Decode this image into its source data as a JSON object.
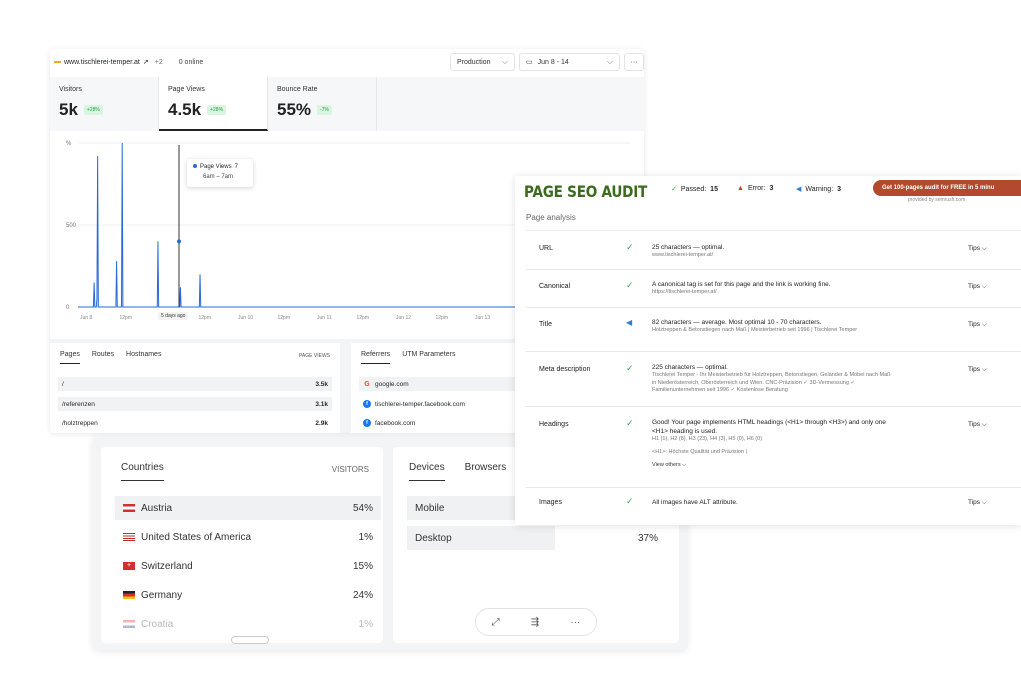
{
  "analytics": {
    "site": "www.tischlerei-temper.at",
    "site_extra": "+2",
    "online": "0 online",
    "environment": "Production",
    "date_range": "Jun 8 - 14",
    "more": "···",
    "metrics": [
      {
        "label": "Visitors",
        "value": "5k",
        "badge": "+28%"
      },
      {
        "label": "Page Views",
        "value": "4.5k",
        "badge": "+28%"
      },
      {
        "label": "Bounce Rate",
        "value": "55%",
        "badge": "-7%"
      }
    ],
    "tooltip": {
      "series": "Page Views",
      "value": "7",
      "time": "6am – 7am"
    },
    "days_ago": "5 days ago",
    "pages_card": {
      "tabs": [
        "Pages",
        "Routes",
        "Hostnames"
      ],
      "column": "PAGE VIEWS",
      "rows": [
        {
          "label": "/",
          "value": "3.5k"
        },
        {
          "label": "/referenzen",
          "value": "3.1k"
        },
        {
          "label": "/holztreppen",
          "value": "2.9k"
        }
      ]
    },
    "referrers_card": {
      "tabs": [
        "Referrers",
        "UTM Parameters"
      ],
      "rows": [
        {
          "label": "google.com",
          "icon": "google-icon"
        },
        {
          "label": "tischlerei-temper.facebook.com",
          "icon": "facebook-icon"
        },
        {
          "label": "facebook.com",
          "icon": "facebook-icon"
        }
      ]
    }
  },
  "chart_data": {
    "type": "area",
    "title": "",
    "xlabel": "",
    "ylabel": "",
    "y_ticks": [
      "%",
      "500",
      "0"
    ],
    "x_ticks": [
      "Jun 8",
      "12pm",
      "Jun 9",
      "12pm",
      "Jun 10",
      "12pm",
      "Jun 11",
      "12pm",
      "Jun 12",
      "12pm",
      "Jun 13",
      "12pm"
    ],
    "ylim": [
      0,
      1000
    ],
    "series": [
      {
        "name": "Page Views",
        "color": "#2a6ad8",
        "values": [
          0,
          0,
          0,
          0,
          0,
          0,
          0,
          0,
          0,
          0,
          0,
          0,
          0,
          0,
          0,
          0,
          0,
          0,
          0,
          0,
          0,
          0,
          0,
          150,
          0,
          0,
          0,
          50,
          920,
          0,
          0,
          0,
          0,
          0,
          0,
          0,
          0,
          0,
          0,
          0,
          0,
          0,
          0,
          0,
          0,
          0,
          0,
          0,
          0,
          0,
          0,
          0,
          0,
          0,
          0,
          280,
          0,
          0,
          0,
          0,
          0,
          0,
          0,
          1000,
          0,
          0,
          0,
          0,
          0,
          0,
          0,
          0,
          0,
          0,
          0,
          0,
          0,
          0,
          0,
          0,
          0,
          0,
          0,
          0,
          0,
          0,
          0,
          0,
          0,
          0,
          0,
          0,
          0,
          0,
          0,
          0,
          0,
          0,
          0,
          0,
          0,
          0,
          0,
          0,
          0,
          0,
          0,
          0,
          0,
          0,
          0,
          0,
          0,
          0,
          400,
          0,
          0,
          0,
          0,
          0,
          0,
          0,
          0,
          0,
          0,
          0,
          0,
          0,
          0,
          0,
          0,
          0,
          0,
          0,
          0,
          0,
          0,
          0,
          0,
          0,
          0,
          0,
          0,
          0,
          0,
          0,
          120,
          0,
          0,
          0,
          0,
          0,
          0,
          0,
          0,
          0,
          0,
          0,
          0,
          0,
          0,
          0,
          0,
          0,
          0,
          0,
          0,
          0,
          0,
          0,
          0,
          0,
          0,
          0,
          200,
          0,
          0,
          0,
          0,
          0,
          0,
          0,
          0,
          0,
          0,
          0,
          0,
          0,
          0,
          0,
          0,
          0,
          0,
          0,
          0,
          0,
          0,
          0,
          0,
          0,
          0,
          0,
          0,
          0,
          0,
          0,
          0,
          0,
          0,
          0,
          0,
          0,
          0,
          0,
          0,
          0,
          0,
          0,
          0,
          0,
          0,
          0,
          0,
          0,
          0,
          0,
          0,
          0,
          0,
          0,
          0,
          0,
          0,
          0,
          0,
          0,
          0,
          0,
          0,
          0,
          0,
          0,
          0,
          0,
          0,
          0,
          0,
          0,
          0,
          0,
          0,
          0,
          0,
          0,
          0,
          0,
          0,
          0,
          0,
          0,
          0,
          0,
          0,
          0,
          0,
          0,
          0,
          0,
          0,
          0,
          0,
          0,
          0,
          0,
          0,
          0,
          0,
          0,
          0,
          0,
          0,
          0,
          0,
          0,
          0,
          0,
          0,
          0,
          0,
          0,
          0,
          0,
          0,
          0,
          0,
          0,
          0,
          0,
          0,
          0,
          0,
          0,
          0,
          0,
          0,
          0,
          0,
          0,
          0,
          0,
          0,
          0,
          0,
          0,
          0,
          0,
          0,
          0,
          0,
          0,
          0,
          0,
          0,
          0,
          0,
          0,
          0,
          0,
          0,
          0,
          0,
          0,
          0,
          0,
          0,
          0,
          0,
          0,
          0,
          0,
          0,
          0,
          0,
          0,
          0,
          0,
          0,
          0,
          0,
          0,
          0,
          0,
          0,
          0,
          0,
          0,
          0,
          0,
          0,
          0,
          0,
          0,
          0,
          0,
          0,
          0,
          0,
          0,
          0,
          0,
          0,
          0,
          0,
          0,
          0,
          0,
          0,
          0,
          0,
          0,
          0,
          0,
          0,
          0,
          0,
          0,
          0,
          0,
          0,
          0,
          0,
          0,
          0,
          0,
          0,
          0,
          0,
          0,
          0,
          0,
          0,
          0,
          0,
          0,
          0,
          0,
          0,
          0,
          0,
          0,
          0,
          0,
          0,
          0,
          0,
          0,
          0,
          0,
          0,
          0,
          0,
          0,
          0,
          0,
          0,
          0,
          0,
          0,
          0,
          0,
          0,
          0,
          0,
          0,
          0,
          0,
          0,
          0,
          0,
          0,
          0,
          0,
          0,
          0,
          0,
          0,
          0,
          0,
          0,
          0,
          0,
          0,
          0,
          0,
          0,
          0,
          0,
          0,
          0,
          0,
          0,
          0,
          0,
          0,
          0,
          0,
          0,
          0,
          0,
          0,
          0,
          0,
          0,
          0,
          0,
          0,
          0,
          0,
          0,
          0,
          0,
          0,
          0,
          0,
          0,
          0,
          0,
          0,
          0,
          0,
          0,
          0,
          0,
          0,
          0,
          0,
          0,
          0,
          0,
          0,
          0,
          0,
          0,
          0,
          0,
          0,
          0,
          0,
          0,
          0,
          0,
          0,
          0,
          0,
          0,
          0,
          0,
          0,
          0,
          0,
          0,
          0,
          0,
          0,
          0,
          0,
          0,
          0,
          0,
          0,
          0,
          0,
          0,
          0,
          0,
          0,
          0,
          0,
          0,
          0,
          0,
          0,
          0,
          0,
          0,
          0,
          0,
          0,
          0,
          0,
          0,
          0,
          0,
          0,
          0,
          0,
          0,
          0,
          0,
          0,
          0,
          0,
          0,
          0,
          0,
          0,
          0,
          0,
          0,
          0,
          0,
          0,
          0,
          0,
          0,
          0,
          0,
          0,
          0,
          0,
          0,
          0,
          0,
          0,
          0,
          0,
          0,
          0,
          0,
          0,
          0,
          0,
          0,
          0,
          0,
          0,
          0,
          0,
          0,
          0,
          0,
          0,
          0,
          0,
          0,
          0,
          0,
          0,
          0,
          0,
          0,
          0,
          0,
          0,
          0,
          0,
          0,
          0,
          0,
          0,
          0,
          0,
          0,
          0,
          0,
          0,
          0,
          0,
          0,
          0,
          0,
          0,
          0,
          0,
          0,
          0,
          0,
          0,
          0,
          0,
          0,
          0,
          0,
          0,
          0,
          0,
          0,
          0,
          0,
          0,
          0,
          0,
          0,
          0,
          0,
          0,
          0,
          0,
          0,
          0,
          0,
          0,
          0,
          0,
          0,
          0,
          0,
          0,
          0,
          0,
          0,
          0,
          0,
          0,
          0,
          0,
          0,
          0,
          0,
          0,
          0,
          0,
          0,
          0,
          0,
          0,
          0,
          0,
          0,
          0,
          0,
          0,
          0,
          0,
          0,
          0,
          0,
          0,
          0,
          0,
          0,
          0,
          0,
          0,
          0,
          0,
          0,
          0,
          0,
          0,
          0,
          0,
          0,
          0,
          0,
          0,
          0,
          0,
          0,
          0,
          0,
          0,
          0,
          0,
          0,
          0,
          0,
          0,
          0,
          0,
          0,
          0,
          0,
          0,
          0,
          0,
          0,
          0,
          0,
          0,
          0,
          0,
          0,
          0,
          0,
          0,
          0,
          0,
          0,
          0,
          0,
          0,
          0,
          0,
          0,
          0,
          0,
          0,
          0,
          0,
          0,
          0,
          0,
          0,
          0,
          0,
          0,
          0,
          0,
          0,
          0,
          0,
          0,
          0,
          0,
          0,
          0,
          0,
          0,
          0,
          0,
          0,
          0,
          0,
          0,
          0,
          0,
          0
        ]
      }
    ]
  },
  "countries": {
    "tabs": [
      "Countries"
    ],
    "column": "VISITORS",
    "rows": [
      {
        "label": "Austria",
        "value": "54%"
      },
      {
        "label": "United States of America",
        "value": "1%"
      },
      {
        "label": "Switzerland",
        "value": "15%"
      },
      {
        "label": "Germany",
        "value": "24%"
      },
      {
        "label": "Croatia",
        "value": "1%"
      }
    ]
  },
  "devices": {
    "tabs": [
      "Devices",
      "Browsers"
    ],
    "rows": [
      {
        "label": "Mobile",
        "value": ""
      },
      {
        "label": "Desktop",
        "value": "37%"
      }
    ]
  },
  "seo": {
    "title": "PAGE SEO AUDIT",
    "passed_label": "Passed:",
    "passed": "15",
    "error_label": "Error:",
    "error": "3",
    "warning_label": "Warning:",
    "warning": "3",
    "cta": "Get 100-pages audit for FREE in 5 minu",
    "provided": "provided by semrush.com",
    "section": "Page analysis",
    "tips": "Tips",
    "rows": [
      {
        "name": "URL",
        "status": "ok",
        "text": "25 characters — optimal.",
        "sub": "www.tischlerei-temper.at/"
      },
      {
        "name": "Canonical",
        "status": "ok",
        "text": "A canonical tag is set for this page and the link is working fine.",
        "sub": "https://tischlerei-temper.at/"
      },
      {
        "name": "Title",
        "status": "warn",
        "text": "82 characters — average. Most optimal 10 - 70 characters.",
        "sub": "Holztreppen & Betonstiegen nach Maß | Meisterbetrieb seit 1996 | Tischlerei Temper"
      },
      {
        "name": "Meta description",
        "status": "ok",
        "text": "225 characters — optimal.",
        "sub": "Tischlerei Temper - Ihr Meisterbetrieb für Holztreppen, Betonstiegen, Geländer & Möbel nach Maß in Niederösterreich, Oberösterreich und Wien. CNC-Präzision ✓ 3D-Vermessung ✓ Familienunternehmen seit 1996 ✓ Kostenlose Beratung"
      },
      {
        "name": "Headings",
        "status": "ok",
        "text": "Good! Your page implements HTML headings (<H1> through <H3>) and only one <H1> heading is used.",
        "sub": "H1 (1), H2 (8), H3 (23), H4 (3), H5 (0), H6 (0)",
        "extra": "<H1>: Höchste Qualität und Präzision  |",
        "more": "View others"
      },
      {
        "name": "Images",
        "status": "ok",
        "text": "All images have ALT attribute.",
        "sub": ""
      }
    ]
  }
}
